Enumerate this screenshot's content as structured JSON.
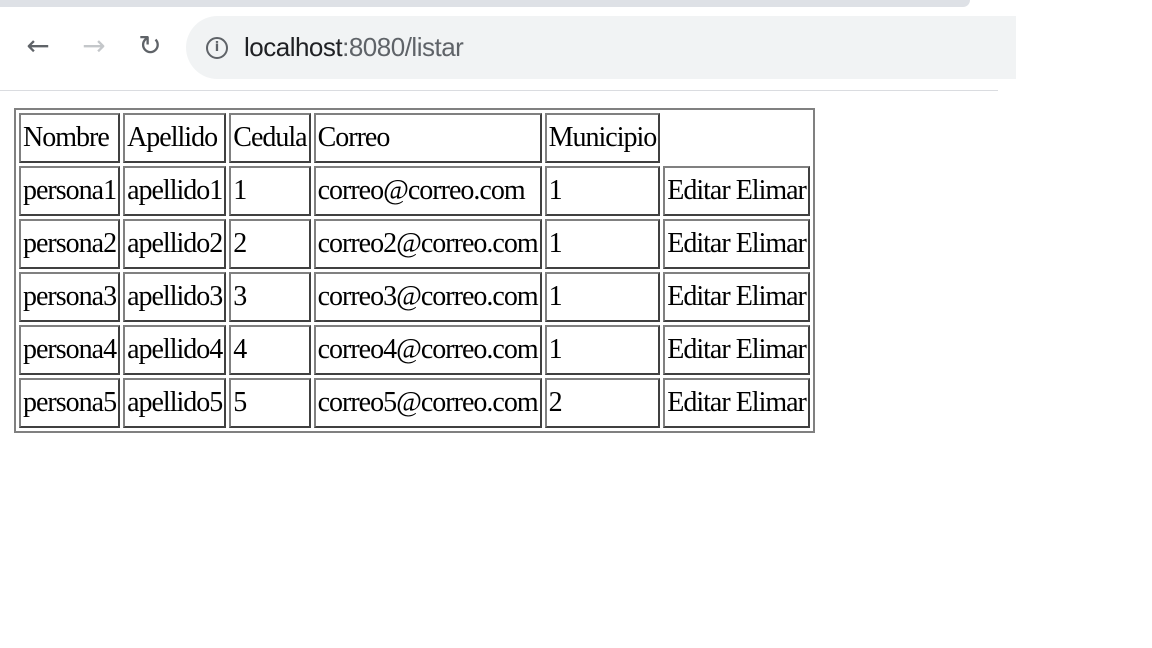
{
  "browser": {
    "url_host": "localhost",
    "url_path": ":8080/listar",
    "back_icon": "arrow-left-icon",
    "forward_icon": "arrow-right-icon",
    "reload_icon": "reload-icon",
    "info_icon": "info-icon"
  },
  "table": {
    "headers": [
      "Nombre",
      "Apellido",
      "Cedula",
      "Correo",
      "Municipio",
      ""
    ],
    "rows": [
      {
        "nombre": "persona1",
        "apellido": "apellido1",
        "cedula": "1",
        "correo": "correo@correo.com",
        "municipio": "1",
        "editar": "Editar",
        "eliminar": "Elimar"
      },
      {
        "nombre": "persona2",
        "apellido": "apellido2",
        "cedula": "2",
        "correo": "correo2@correo.com",
        "municipio": "1",
        "editar": "Editar",
        "eliminar": "Elimar"
      },
      {
        "nombre": "persona3",
        "apellido": "apellido3",
        "cedula": "3",
        "correo": "correo3@correo.com",
        "municipio": "1",
        "editar": "Editar",
        "eliminar": "Elimar"
      },
      {
        "nombre": "persona4",
        "apellido": "apellido4",
        "cedula": "4",
        "correo": "correo4@correo.com",
        "municipio": "1",
        "editar": "Editar",
        "eliminar": "Elimar"
      },
      {
        "nombre": "persona5",
        "apellido": "apellido5",
        "cedula": "5",
        "correo": "correo5@correo.com",
        "municipio": "2",
        "editar": "Editar",
        "eliminar": "Elimar"
      }
    ]
  }
}
